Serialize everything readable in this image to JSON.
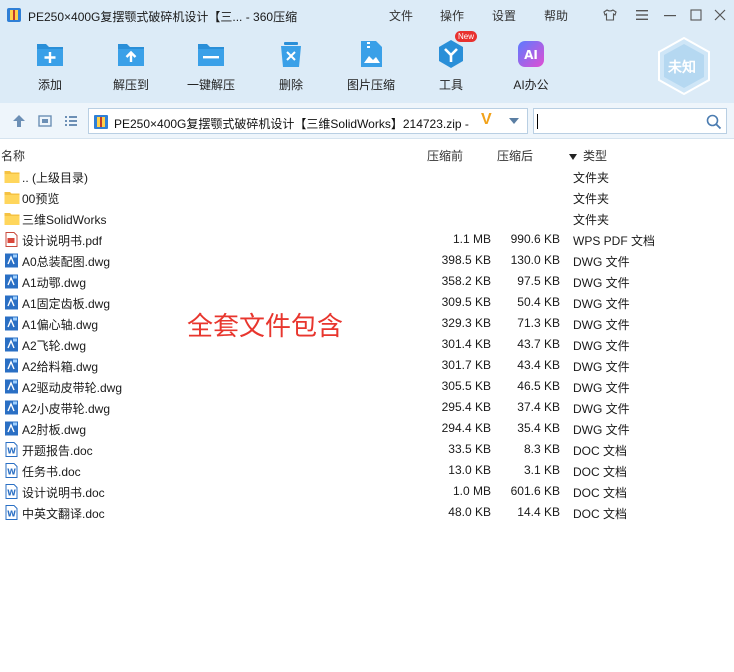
{
  "window": {
    "title": "PE250×400G复摆颚式破碎机设计【三... - 360压缩",
    "menu": [
      "文件",
      "操作",
      "设置",
      "帮助"
    ],
    "buttons": [
      "shirt-icon",
      "menu-icon",
      "minimize-icon",
      "maximize-icon",
      "close-icon"
    ]
  },
  "toolbar": {
    "items": [
      {
        "label": "添加",
        "icon": "add-icon"
      },
      {
        "label": "解压到",
        "icon": "extract-to-icon"
      },
      {
        "label": "一键解压",
        "icon": "one-click-extract-icon"
      },
      {
        "label": "删除",
        "icon": "delete-icon"
      },
      {
        "label": "图片压缩",
        "icon": "image-compress-icon"
      },
      {
        "label": "工具",
        "icon": "tools-icon",
        "badge": "New"
      },
      {
        "label": "AI办公",
        "icon": "ai-office-icon"
      }
    ],
    "status_badge": "未知"
  },
  "address": {
    "path": "PE250×400G复摆颚式破碎机设计【三维SolidWorks】214723.zip -",
    "search_placeholder": ""
  },
  "columns": {
    "name": "名称",
    "size": "压缩前",
    "compressed": "压缩后",
    "type": "类型"
  },
  "files": [
    {
      "name": ".. (上级目录)",
      "size": "",
      "compressed": "",
      "type": "文件夹",
      "icon": "folder-icon"
    },
    {
      "name": "00预览",
      "size": "",
      "compressed": "",
      "type": "文件夹",
      "icon": "folder-icon"
    },
    {
      "name": "三维SolidWorks",
      "size": "",
      "compressed": "",
      "type": "文件夹",
      "icon": "folder-icon"
    },
    {
      "name": "设计说明书.pdf",
      "size": "1.1 MB",
      "compressed": "990.6 KB",
      "type": "WPS PDF 文档",
      "icon": "pdf-icon"
    },
    {
      "name": "A0总装配图.dwg",
      "size": "398.5 KB",
      "compressed": "130.0 KB",
      "type": "DWG 文件",
      "icon": "dwg-icon"
    },
    {
      "name": "A1动鄂.dwg",
      "size": "358.2 KB",
      "compressed": "97.5 KB",
      "type": "DWG 文件",
      "icon": "dwg-icon"
    },
    {
      "name": "A1固定齿板.dwg",
      "size": "309.5 KB",
      "compressed": "50.4 KB",
      "type": "DWG 文件",
      "icon": "dwg-icon"
    },
    {
      "name": "A1偏心轴.dwg",
      "size": "329.3 KB",
      "compressed": "71.3 KB",
      "type": "DWG 文件",
      "icon": "dwg-icon"
    },
    {
      "name": "A2飞轮.dwg",
      "size": "301.4 KB",
      "compressed": "43.7 KB",
      "type": "DWG 文件",
      "icon": "dwg-icon"
    },
    {
      "name": "A2给料箱.dwg",
      "size": "301.7 KB",
      "compressed": "43.4 KB",
      "type": "DWG 文件",
      "icon": "dwg-icon"
    },
    {
      "name": "A2驱动皮带轮.dwg",
      "size": "305.5 KB",
      "compressed": "46.5 KB",
      "type": "DWG 文件",
      "icon": "dwg-icon"
    },
    {
      "name": "A2小皮带轮.dwg",
      "size": "295.4 KB",
      "compressed": "37.4 KB",
      "type": "DWG 文件",
      "icon": "dwg-icon"
    },
    {
      "name": "A2肘板.dwg",
      "size": "294.4 KB",
      "compressed": "35.4 KB",
      "type": "DWG 文件",
      "icon": "dwg-icon"
    },
    {
      "name": "开题报告.doc",
      "size": "33.5 KB",
      "compressed": "8.3 KB",
      "type": "DOC 文档",
      "icon": "doc-icon"
    },
    {
      "name": "任务书.doc",
      "size": "13.0 KB",
      "compressed": "3.1 KB",
      "type": "DOC 文档",
      "icon": "doc-icon"
    },
    {
      "name": "设计说明书.doc",
      "size": "1.0 MB",
      "compressed": "601.6 KB",
      "type": "DOC 文档",
      "icon": "doc-icon"
    },
    {
      "name": "中英文翻译.doc",
      "size": "48.0 KB",
      "compressed": "14.4 KB",
      "type": "DOC 文档",
      "icon": "doc-icon"
    }
  ],
  "overlay": "全套文件包含",
  "colors": {
    "accent": "#2a8fd8",
    "band": "#dcebf7",
    "overlay": "#e8362e"
  }
}
